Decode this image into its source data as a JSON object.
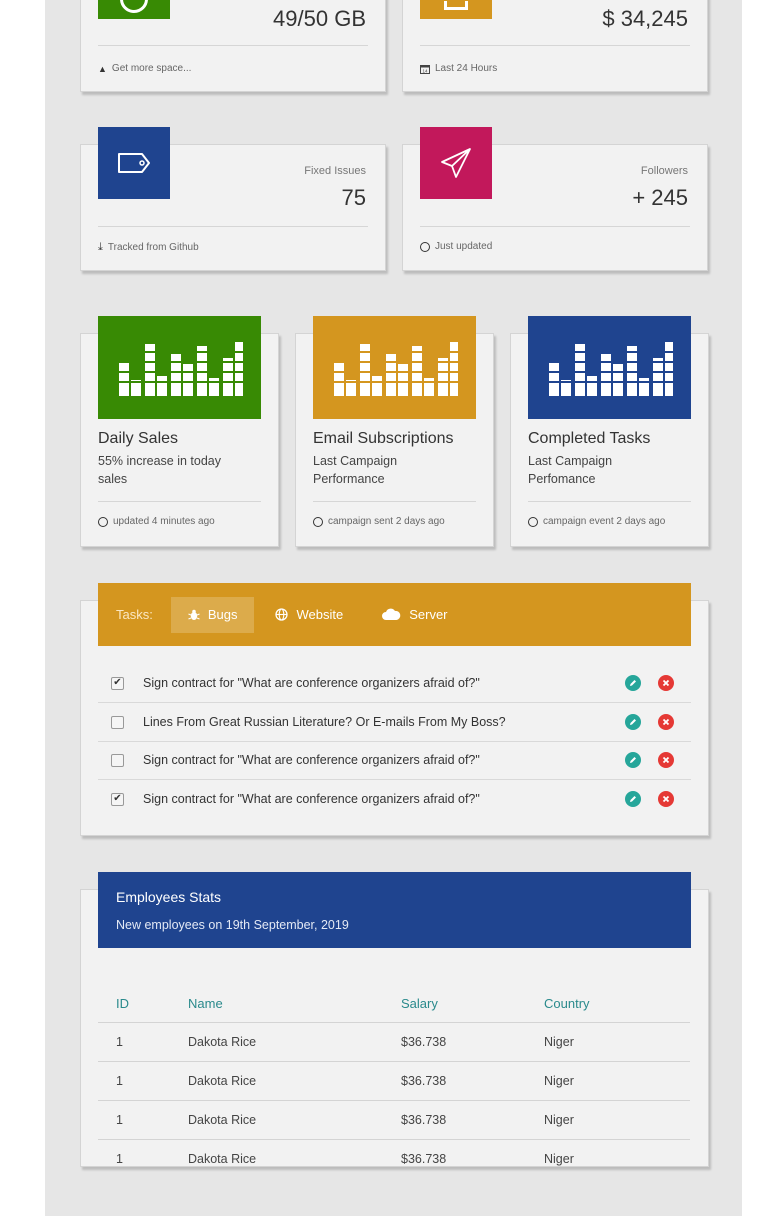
{
  "stats_top": [
    {
      "value": "49/50 GB",
      "footer": "Get more space..."
    },
    {
      "value": "$ 34,245",
      "footer": "Last 24 Hours"
    }
  ],
  "stats_mid": [
    {
      "category": "Fixed Issues",
      "value": "75",
      "footer": "Tracked from Github",
      "color": "#1f448f"
    },
    {
      "category": "Followers",
      "value": "+ 245",
      "footer": "Just updated",
      "color": "#c2185b"
    }
  ],
  "chart_cards": [
    {
      "title": "Daily Sales",
      "subtitle": "55% increase in today sales",
      "footer": "updated 4 minutes ago",
      "color": "#388a04"
    },
    {
      "title": "Email Subscriptions",
      "subtitle": "Last Campaign Performance",
      "footer": "campaign sent 2 days ago",
      "color": "#d4961f"
    },
    {
      "title": "Completed Tasks",
      "subtitle": "Last Campaign Perfomance",
      "footer": "campaign event 2 days ago",
      "color": "#1f448f"
    }
  ],
  "tasks": {
    "caption": "Tasks:",
    "tabs": [
      {
        "label": "Bugs",
        "icon": "bug-icon"
      },
      {
        "label": "Website",
        "icon": "globe-icon"
      },
      {
        "label": "Server",
        "icon": "cloud-icon"
      }
    ],
    "items": [
      {
        "text": "Sign contract for \"What are conference organizers afraid of?\"",
        "checked": true
      },
      {
        "text": "Lines From Great Russian Literature? Or E-mails From My Boss?",
        "checked": false
      },
      {
        "text": "Sign contract for \"What are conference organizers afraid of?\"",
        "checked": false
      },
      {
        "text": "Sign contract for \"What are conference organizers afraid of?\"",
        "checked": true
      }
    ]
  },
  "employees": {
    "title": "Employees Stats",
    "subtitle": "New employees on 19th September, 2019",
    "columns": [
      "ID",
      "Name",
      "Salary",
      "Country"
    ],
    "rows": [
      [
        "1",
        "Dakota Rice",
        "$36.738",
        "Niger"
      ],
      [
        "1",
        "Dakota Rice",
        "$36.738",
        "Niger"
      ],
      [
        "1",
        "Dakota Rice",
        "$36.738",
        "Niger"
      ],
      [
        "1",
        "Dakota Rice",
        "$36.738",
        "Niger"
      ]
    ]
  },
  "colors": {
    "green": "#388a04",
    "orange": "#d4961f",
    "blue": "#1f448f",
    "pink": "#c2185b",
    "teal": "#26a69a",
    "red": "#e53935"
  }
}
